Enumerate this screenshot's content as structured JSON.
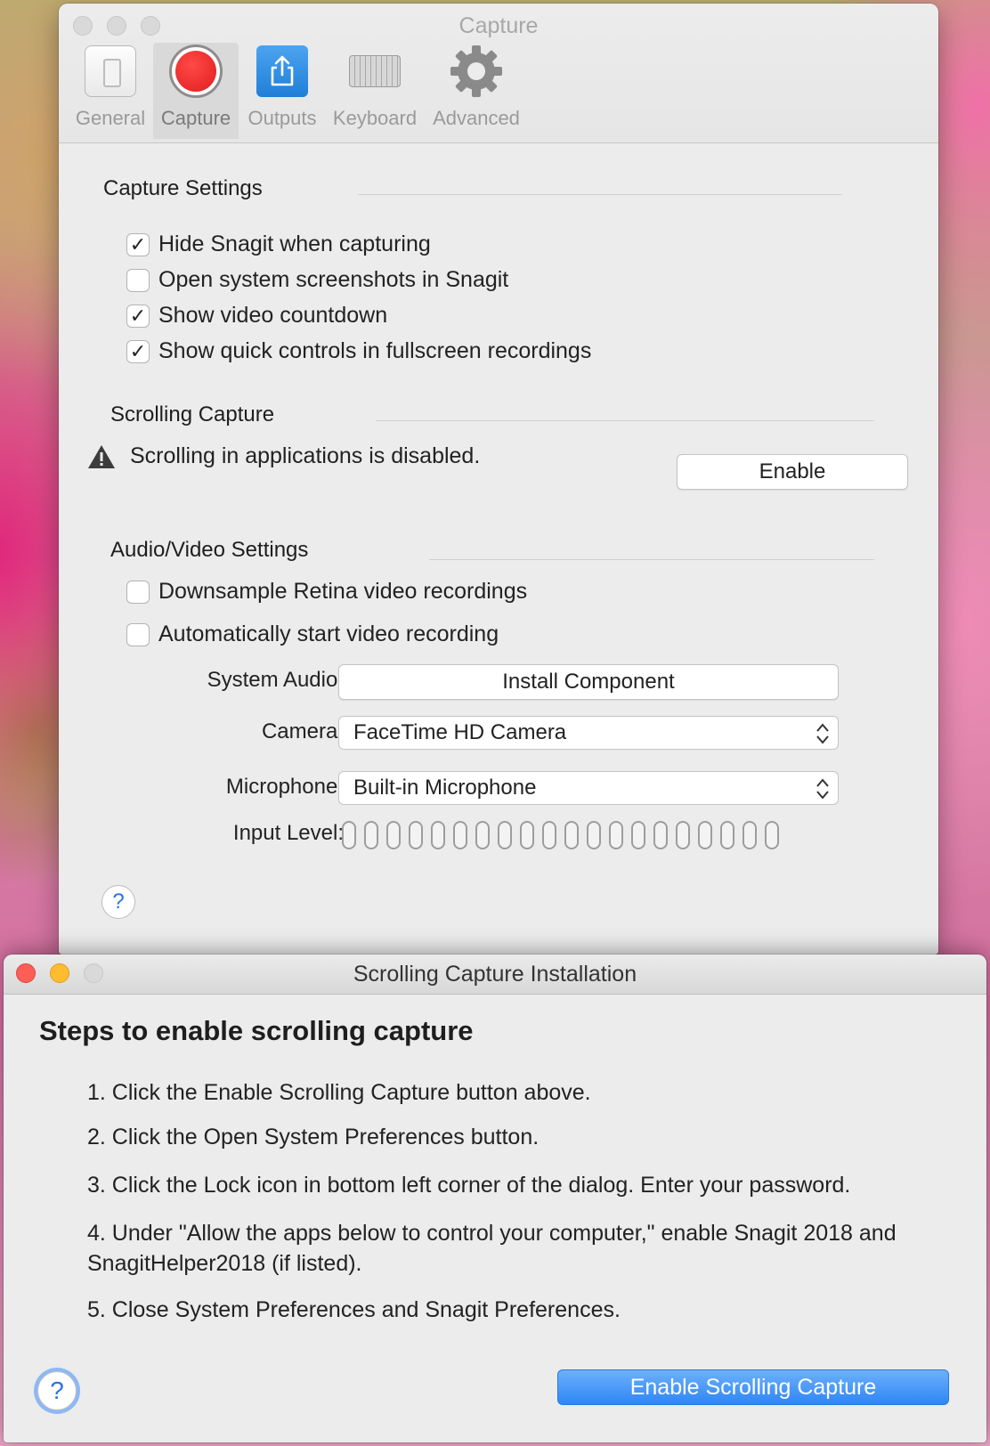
{
  "prefs_window": {
    "title": "Capture",
    "toolbar": [
      {
        "label": "General",
        "icon": "general-icon"
      },
      {
        "label": "Capture",
        "icon": "record-icon",
        "selected": true
      },
      {
        "label": "Outputs",
        "icon": "share-icon"
      },
      {
        "label": "Keyboard",
        "icon": "keyboard-icon"
      },
      {
        "label": "Advanced",
        "icon": "gear-icon"
      }
    ],
    "capture_settings": {
      "heading": "Capture Settings",
      "options": [
        {
          "label": "Hide Snagit when capturing",
          "checked": true
        },
        {
          "label": "Open system screenshots in Snagit",
          "checked": false
        },
        {
          "label": "Show video countdown",
          "checked": true
        },
        {
          "label": "Show quick controls in fullscreen recordings",
          "checked": true
        }
      ]
    },
    "scrolling_capture": {
      "heading": "Scrolling Capture",
      "warning_icon": "warning-icon",
      "message": "Scrolling in applications is disabled.",
      "enable_label": "Enable"
    },
    "audio_video": {
      "heading": "Audio/Video Settings",
      "options": [
        {
          "label": "Downsample Retina video recordings",
          "checked": false
        },
        {
          "label": "Automatically start video recording",
          "checked": false
        }
      ],
      "system_audio_label": "System Audio:",
      "install_component_label": "Install Component",
      "camera_label": "Camera:",
      "camera_value": "FaceTime HD Camera",
      "microphone_label": "Microphone:",
      "microphone_value": "Built-in Microphone",
      "input_level_label": "Input Level:",
      "input_level_segments": 20,
      "input_level_value": 0
    },
    "help_symbol": "?"
  },
  "install_window": {
    "title": "Scrolling Capture Installation",
    "heading": "Steps to enable scrolling capture",
    "steps": [
      "1. Click the Enable Scrolling Capture button above.",
      "2. Click the Open System Preferences button.",
      "3. Click the Lock icon in bottom left corner of the dialog. Enter your password.",
      "4. Under \"Allow the apps below to control your computer,\" enable Snagit 2018 and SnagitHelper2018 (if listed).",
      "5. Close System Preferences and Snagit Preferences."
    ],
    "primary_button": "Enable Scrolling Capture",
    "help_symbol": "?"
  },
  "colors": {
    "accent": "#2f86f5",
    "record_red": "#e01d1d",
    "close_red": "#fd5f57",
    "minimize_yellow": "#febc2e"
  }
}
